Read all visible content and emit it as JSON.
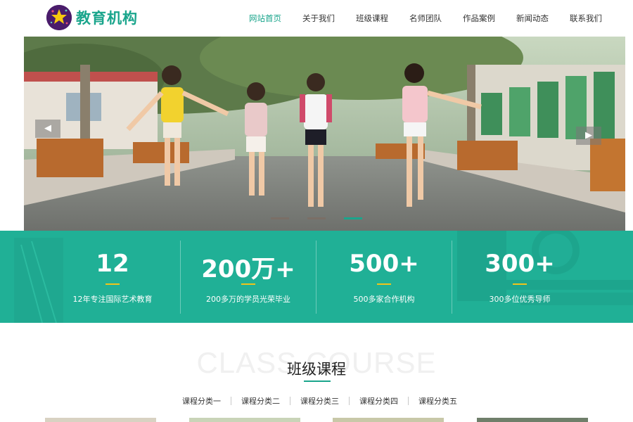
{
  "header": {
    "logo_text": "教育机构",
    "nav": [
      {
        "label": "网站首页",
        "active": true
      },
      {
        "label": "关于我们",
        "active": false
      },
      {
        "label": "班级课程",
        "active": false
      },
      {
        "label": "名师团队",
        "active": false
      },
      {
        "label": "作品案例",
        "active": false
      },
      {
        "label": "新闻动态",
        "active": false
      },
      {
        "label": "联系我们",
        "active": false
      }
    ]
  },
  "banner": {
    "prev_icon": "arrow-left-icon",
    "next_icon": "arrow-right-icon",
    "slide_count": 3,
    "active_slide": 3
  },
  "stats": [
    {
      "number": "12",
      "text": "12年专注国际艺术教育"
    },
    {
      "number": "200万+",
      "text": "200多万的学员光荣毕业"
    },
    {
      "number": "500+",
      "text": "500多家合作机构"
    },
    {
      "number": "300+",
      "text": "300多位优秀导师"
    }
  ],
  "courses": {
    "bg_text": "CLASS COURSE",
    "title": "班级课程",
    "categories": [
      "课程分类一",
      "课程分类二",
      "课程分类三",
      "课程分类四",
      "课程分类五"
    ]
  },
  "colors": {
    "accent": "#1aa58c",
    "stats_bg": "#20b096",
    "highlight": "#f0c419",
    "logo_bg": "#4a1c6b"
  }
}
